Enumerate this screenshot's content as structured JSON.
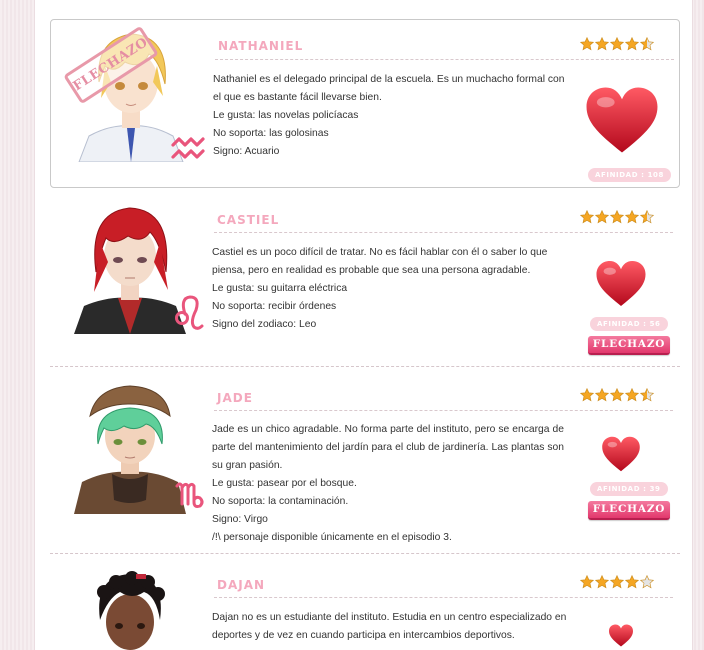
{
  "characters": [
    {
      "name": "NATHANIEL",
      "rating": 4.5,
      "description": "Nathaniel es el delegado principal de la escuela. Es un muchacho formal con el que es bastante fácil llevarse bien.",
      "likes": "Le gusta: las novelas policíacas",
      "dislikes": "No soporta: las golosinas",
      "sign": "Signo: Acuario",
      "affinity": "AFINIDAD : 108",
      "stamp": "FLECHAZO",
      "sign_icon": "aquarius-icon",
      "hair_color": "#f2c85a"
    },
    {
      "name": "CASTIEL",
      "rating": 4.5,
      "description": "Castiel es un poco difícil de tratar. No es fácil hablar con él o saber lo que piensa, pero en realidad es probable que sea una persona agradable.",
      "likes": "Le gusta: su guitarra eléctrica",
      "dislikes": "No soporta: recibir órdenes",
      "sign": "Signo del zodiaco: Leo",
      "affinity": "AFINIDAD : 56",
      "button": "FLECHAZO",
      "sign_icon": "leo-icon",
      "hair_color": "#c81e26"
    },
    {
      "name": "JADE",
      "rating": 4.5,
      "description": "Jade es un chico agradable. No forma parte del instituto, pero se encarga de parte del mantenimiento del jardín para el club de jardinería. Las plantas son su gran pasión.",
      "likes": "Le gusta: pasear por el bosque.",
      "dislikes": "No soporta: la contaminación.",
      "sign": "Signo: Virgo",
      "note": "/!\\ personaje disponible únicamente en el episodio 3.",
      "affinity": "AFINIDAD : 39",
      "button": "FLECHAZO",
      "sign_icon": "virgo-icon",
      "hair_color": "#5fcf9a"
    },
    {
      "name": "DAJAN",
      "rating": 4,
      "description": "Dajan no es un estudiante del instituto. Estudia en un centro especializado en deportes y de vez en cuando participa en intercambios deportivos.",
      "hair_color": "#1a1414"
    }
  ],
  "colors": {
    "name_pink": "#f4a8bd",
    "heart_red": "#e01e36",
    "star_gold": "#f5a623",
    "button_pink": "#e3386d",
    "sign_pink": "#e9557c"
  }
}
